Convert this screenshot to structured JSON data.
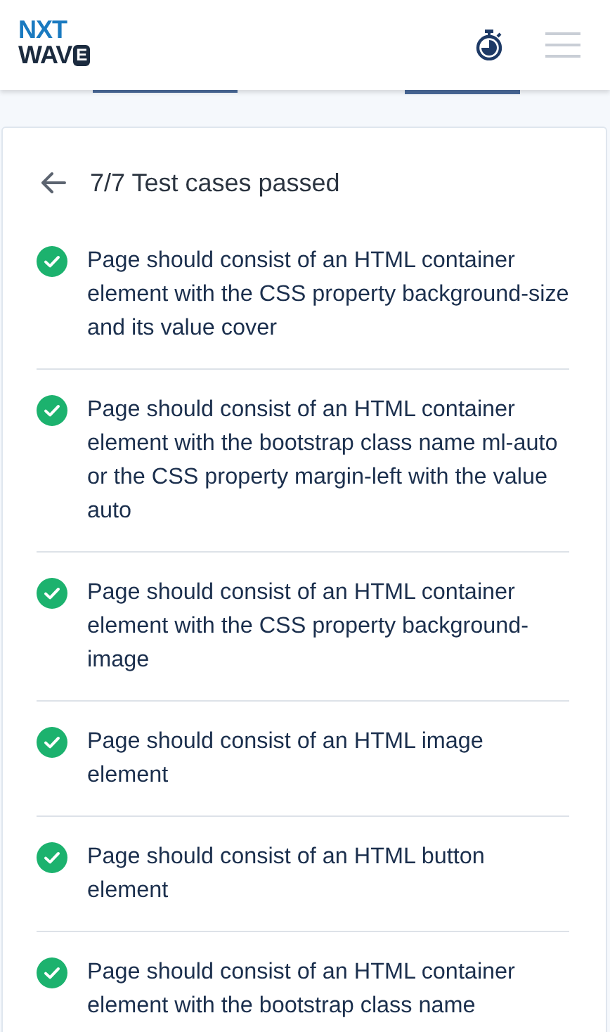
{
  "header": {
    "logo_top": "NXT",
    "logo_bottom": "WAV",
    "logo_badge": "E"
  },
  "results": {
    "title": "7/7 Test cases passed",
    "cases": [
      {
        "text": "Page should consist of an HTML container element with the CSS property background-size and its value cover",
        "passed": true
      },
      {
        "text": "Page should consist of an HTML container element with the bootstrap class name ml-auto or the CSS property margin-left with the value auto",
        "passed": true
      },
      {
        "text": "Page should consist of an HTML container element with the CSS property background-image",
        "passed": true
      },
      {
        "text": "Page should consist of an HTML image element",
        "passed": true
      },
      {
        "text": "Page should consist of an HTML button element",
        "passed": true
      },
      {
        "text": "Page should consist of an HTML container element with the bootstrap class name",
        "passed": true
      }
    ]
  }
}
